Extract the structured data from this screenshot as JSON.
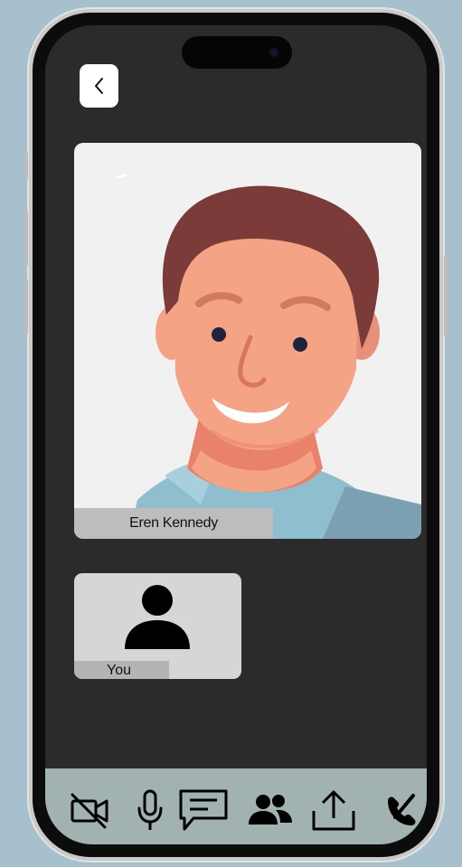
{
  "call": {
    "remote_participant": {
      "name": "Eren Kennedy"
    },
    "local_participant": {
      "label": "You"
    }
  },
  "navigation": {
    "back_icon": "chevron-left-icon"
  },
  "toolbar": {
    "items": [
      {
        "name": "camera-off-icon"
      },
      {
        "name": "microphone-icon"
      },
      {
        "name": "chat-icon"
      },
      {
        "name": "participants-icon"
      },
      {
        "name": "share-icon"
      },
      {
        "name": "end-call-icon"
      }
    ]
  },
  "colors": {
    "background": "#a7c0cd",
    "screen": "#2b2b2b",
    "toolbar": "#a1b2b1",
    "hair": "#7b3b38",
    "skin": "#f4a385",
    "shirt": "#8fbfcf"
  }
}
